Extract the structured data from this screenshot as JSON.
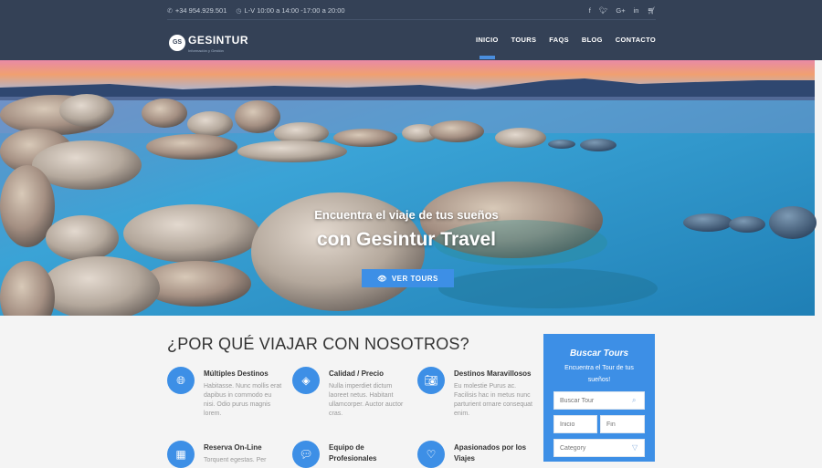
{
  "topbar": {
    "phone": "+34 954.929.501",
    "hours": "L-V 10:00 a 14:00 -17:00 a 20:00",
    "social": [
      "f",
      "t",
      "G+",
      "in",
      "cart"
    ]
  },
  "logo": {
    "name": "GESINTUR",
    "tagline": "Información y Gestión"
  },
  "nav": [
    "INICIO",
    "TOURS",
    "FAQS",
    "BLOG",
    "CONTACTO"
  ],
  "hero": {
    "line1": "Encuentra el viaje de tus sueños",
    "line2": "con Gesintur Travel",
    "button": "VER TOURS"
  },
  "why": {
    "title": "¿POR QUÉ VIAJAR CON NOSOTROS?",
    "features": [
      {
        "icon": "globe-icon",
        "title": "Múltiples Destinos",
        "desc": "Habitasse. Nunc mollis erat dapibus in commodo eu nisi. Odio purus magnis lorem."
      },
      {
        "icon": "tag-icon",
        "title": "Calidad / Precio",
        "desc": "Nulla imperdiet dictum laoreet netus. Habitant ullamcorper. Auctor auctor cras."
      },
      {
        "icon": "camera-icon",
        "title": "Destinos Maravillosos",
        "desc": "Eu molestie Purus ac. Facilisis hac in metus nunc parturient ornare consequat enim."
      },
      {
        "icon": "calendar-icon",
        "title": "Reserva On-Line",
        "desc": "Torquent egestas. Per"
      },
      {
        "icon": "chat-icon",
        "title": "Equipo de Profesionales",
        "desc": ""
      },
      {
        "icon": "heart-icon",
        "title": "Apasionados por los Viajes",
        "desc": ""
      }
    ]
  },
  "search": {
    "title": "Buscar Tours",
    "subtitle": "Encuentra el Tour de tus sueños!",
    "query_placeholder": "Buscar Tour",
    "start_placeholder": "Inicio",
    "end_placeholder": "Fin",
    "category_placeholder": "Category"
  }
}
